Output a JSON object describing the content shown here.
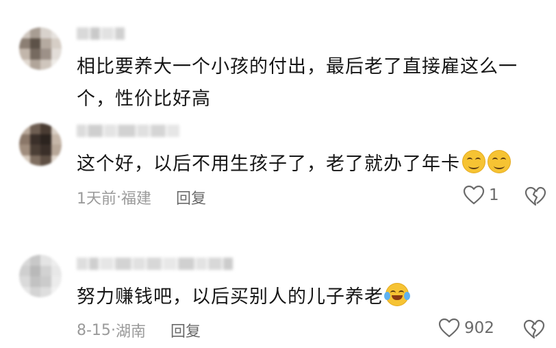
{
  "comments": [
    {
      "text": "相比要养大一个小孩的付出，最后老了直接雇这么一个，性价比好高"
    },
    {
      "text": "这个好，以后不用生孩子了，老了就办了年卡",
      "meta_time": "1天前",
      "meta_sep": " · ",
      "meta_location": "福建",
      "reply_label": "回复",
      "like_count": "1"
    },
    {
      "text": "努力赚钱吧，以后买别人的儿子养老",
      "meta_time": "8-15",
      "meta_sep": " · ",
      "meta_location": "湖南",
      "reply_label": "回复",
      "like_count": "902"
    }
  ],
  "icons": {
    "like": "heart-icon",
    "dislike": "broken-heart-icon",
    "emoji_smile": "smile-emoji-icon",
    "emoji_laugh": "laugh-cry-emoji-icon"
  },
  "colors": {
    "text": "#161616",
    "meta": "#9a9a9a",
    "reply": "#6a6a6a"
  }
}
